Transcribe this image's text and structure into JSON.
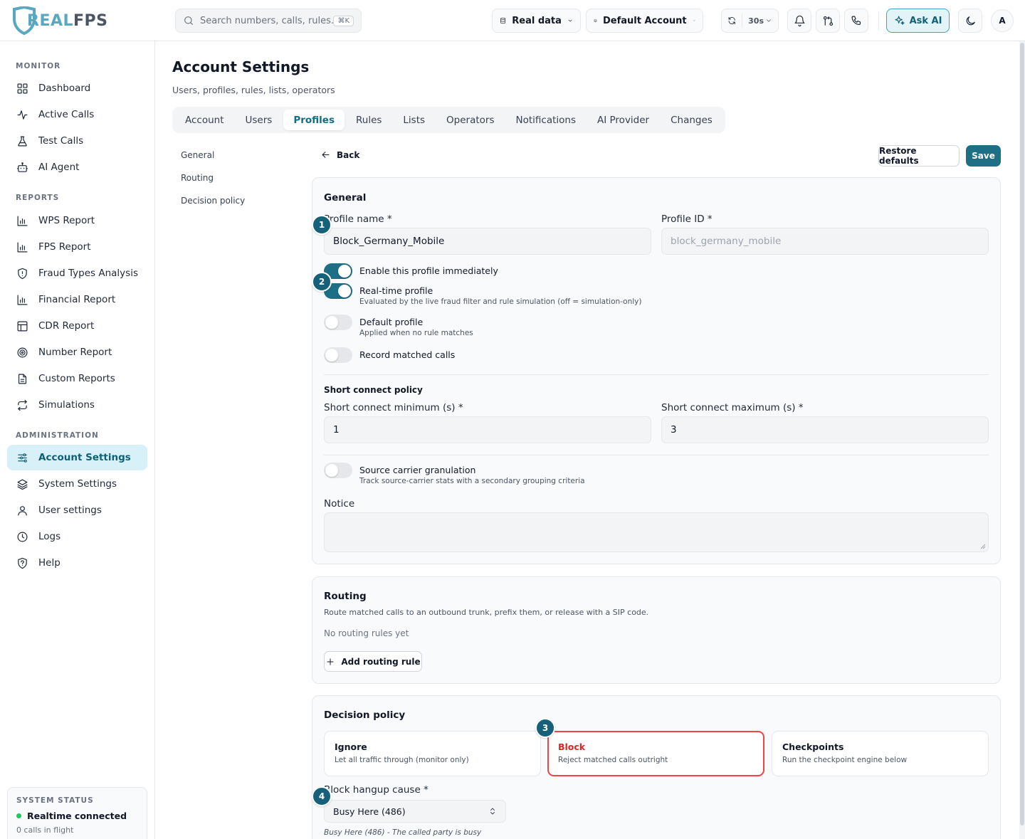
{
  "app": {
    "logo_a": "REAL",
    "logo_b": "FPS"
  },
  "topbar": {
    "search_placeholder": "Search numbers, calls, rules...",
    "search_shortcut": "⌘K",
    "data_source": "Real data",
    "account": "Default Account",
    "refresh_interval": "30s",
    "ask_ai": "Ask AI",
    "avatar_initial": "A"
  },
  "sidebar": {
    "sections": [
      {
        "title": "MONITOR",
        "items": [
          "Dashboard",
          "Active Calls",
          "Test Calls",
          "AI Agent"
        ]
      },
      {
        "title": "REPORTS",
        "items": [
          "WPS Report",
          "FPS Report",
          "Fraud Types Analysis",
          "Financial Report",
          "CDR Report",
          "Number Report",
          "Custom Reports",
          "Simulations"
        ]
      },
      {
        "title": "ADMINISTRATION",
        "items": [
          "Account Settings",
          "System Settings",
          "User settings",
          "Logs",
          "Help"
        ]
      }
    ],
    "active_item": "Account Settings",
    "system_status": {
      "title": "SYSTEM STATUS",
      "status": "Realtime connected",
      "detail": "0 calls in flight"
    }
  },
  "page": {
    "title": "Account Settings",
    "subtitle": "Users, profiles, rules, lists, operators",
    "tabs": [
      "Account",
      "Users",
      "Profiles",
      "Rules",
      "Lists",
      "Operators",
      "Notifications",
      "AI Provider",
      "Changes"
    ],
    "active_tab": "Profiles",
    "subnav": [
      "General",
      "Routing",
      "Decision policy"
    ],
    "back_label": "Back",
    "restore_label": "Restore defaults",
    "save_label": "Save"
  },
  "general": {
    "title": "General",
    "profile_name_label": "Profile name *",
    "profile_name_value": "Block_Germany_Mobile",
    "profile_id_label": "Profile ID *",
    "profile_id_value": "block_germany_mobile",
    "toggles": [
      {
        "label": "Enable this profile immediately",
        "desc": "",
        "on": true
      },
      {
        "label": "Real-time profile",
        "desc": "Evaluated by the live fraud filter and rule simulation (off = simulation-only)",
        "on": true
      },
      {
        "label": "Default profile",
        "desc": "Applied when no rule matches",
        "on": false
      },
      {
        "label": "Record matched calls",
        "desc": "",
        "on": false
      }
    ],
    "short_connect_title": "Short connect policy",
    "short_min_label": "Short connect minimum (s) *",
    "short_min_value": "1",
    "short_max_label": "Short connect maximum (s) *",
    "short_max_value": "3",
    "granulation_label": "Source carrier granulation",
    "granulation_desc": "Track source-carrier stats with a secondary grouping criteria",
    "notice_label": "Notice"
  },
  "routing": {
    "title": "Routing",
    "desc": "Route matched calls to an outbound trunk, prefix them, or release with a SIP code.",
    "empty": "No routing rules yet",
    "add_label": "Add routing rule"
  },
  "decision": {
    "title": "Decision policy",
    "options": [
      {
        "label": "Ignore",
        "desc": "Let all traffic through (monitor only)"
      },
      {
        "label": "Block",
        "desc": "Reject matched calls outright"
      },
      {
        "label": "Checkpoints",
        "desc": "Run the checkpoint engine below"
      }
    ],
    "selected": "Block",
    "hangup_label": "Block hangup cause *",
    "hangup_value": "Busy Here (486)",
    "hangup_hint": "Busy Here (486) - The called party is busy"
  },
  "badges": [
    "1",
    "2",
    "3",
    "4"
  ],
  "colors": {
    "accent": "#1d6f86",
    "accent_light": "#d8f0f7",
    "danger": "#ef4444",
    "status_ok": "#22c55e"
  }
}
